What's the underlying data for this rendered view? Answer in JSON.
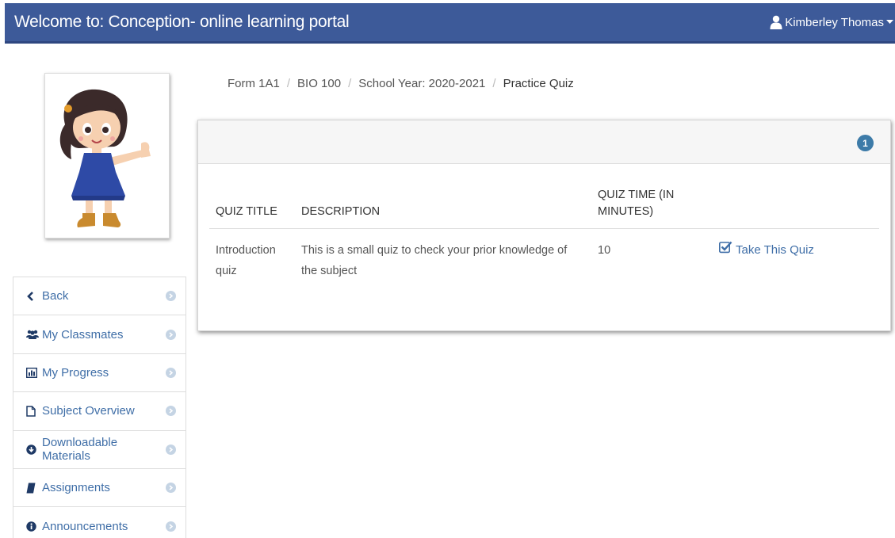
{
  "header": {
    "title": "Welcome to: Conception- online learning portal",
    "user_name": "Kimberley Thomas",
    "bg_color": "#3d5a99"
  },
  "breadcrumb": {
    "items": [
      "Form 1A1",
      "BIO 100",
      "School Year: 2020-2021"
    ],
    "active": "Practice Quiz"
  },
  "sidebar": {
    "items": [
      {
        "label": "Back",
        "icon": "chevron-left-icon"
      },
      {
        "label": "My Classmates",
        "icon": "users-icon"
      },
      {
        "label": "My Progress",
        "icon": "bar-chart-icon"
      },
      {
        "label": "Subject Overview",
        "icon": "file-icon"
      },
      {
        "label": "Downloadable Materials",
        "icon": "download-icon"
      },
      {
        "label": "Assignments",
        "icon": "book-icon"
      },
      {
        "label": "Announcements",
        "icon": "info-icon"
      }
    ]
  },
  "panel": {
    "badge_count": "1",
    "columns": {
      "title": "QUIZ TITLE",
      "description": "DESCRIPTION",
      "time": "QUIZ TIME (IN MINUTES)"
    },
    "rows": [
      {
        "title": "Introduction quiz",
        "description": "This is a small quiz to check your prior knowledge of the subject",
        "time": "10",
        "action": "Take This Quiz"
      }
    ]
  },
  "colors": {
    "link": "#3f6ea7",
    "badge": "#3d7ba8"
  }
}
